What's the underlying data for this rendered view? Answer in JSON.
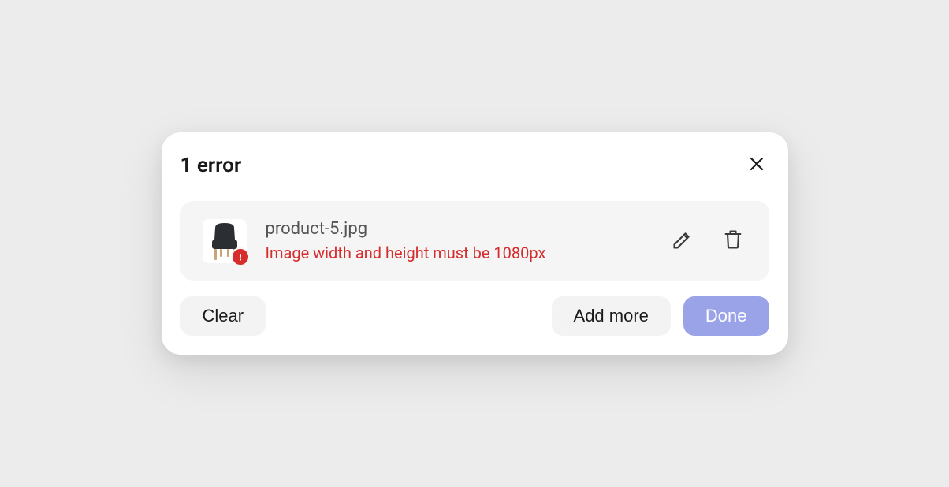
{
  "modal": {
    "title": "1 error"
  },
  "file": {
    "name": "product-5.jpg",
    "error_message": "Image width and height must be 1080px"
  },
  "actions": {
    "clear": "Clear",
    "add_more": "Add more",
    "done": "Done"
  },
  "colors": {
    "error": "#d62c2c",
    "primary": "#9aa2e8"
  }
}
